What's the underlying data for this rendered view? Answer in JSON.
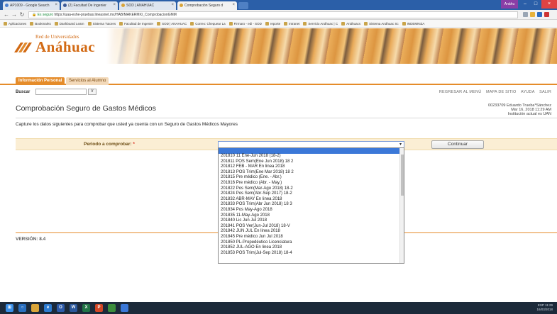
{
  "browser": {
    "tabs": [
      {
        "label": "AP1009 - Google Search"
      },
      {
        "label": "(2) Facultad De Ingenier"
      },
      {
        "label": "SOD | ANAHUAC"
      },
      {
        "label": "Comprobación Seguro d"
      }
    ],
    "active_tab": 3,
    "window_user": "Anáhu",
    "url_secure": "Es seguro",
    "url": "https://uaa-eshe-pruebas.lineasnet.mx/HAB/MAKERMX/_ComprobacionGMM",
    "bookmarks": [
      "Aplicaciones",
      "Bookmarks",
      "Dashboard Learn",
      "Sistema Tutores",
      "Facultad de Ingenier",
      "SOD | ANAHUAC",
      "Correo: Chequear La",
      "Firmaro - edi - SOD",
      "reporte",
      "Intranet",
      "Servicio Anáhuac | C",
      "Anáhuacs",
      "Sistema Anáhuac Sc",
      "INDEMNIZA"
    ]
  },
  "header": {
    "logo_small": "Red de Universidades",
    "logo_big": "Anáhuac"
  },
  "app_tabs": [
    {
      "label": "Información Personal",
      "active": true
    },
    {
      "label": "Servicios al Alumno",
      "active": false
    }
  ],
  "search": {
    "label": "Buscar",
    "value": "",
    "go_label": "Ir"
  },
  "top_links": [
    "REGRESAR AL MENÚ",
    "MAPA DE SITIO",
    "AYUDA",
    "SALIR"
  ],
  "page": {
    "title": "Comprobación Seguro de Gastos Médicos",
    "user_id_line": "00233709 Eduardo Trueba*Sánchez",
    "date_line": "Mar 16, 2018 11:29 AM",
    "institution_line": "Institución actual es UAN",
    "instruction": "Capture los datos siguientes para comprobar que usted ya cuenta con un Seguro de Gastos Médicos Mayores"
  },
  "form": {
    "period_label": "Periodo a comprobar:",
    "required_mark": "*",
    "period_value": "",
    "continue_label": "Continuar",
    "period_options": [
      "201810 11 Ene-Jun 2018 (18-2)",
      "201811 POS Sem(Ene Jun 2018) 18 2",
      "201812 FEB - MAR En linea 2018",
      "201813 POS Trim(Ene Mar 2018) 18 2",
      "201815 Pre médico (Ene. - Abr.)",
      "201816 Pre médico (Abr. - May.)",
      "201822 Pos Sem(Mar-Ago 2018) 18-2",
      "201824 Pos Sem(Abr-Sep 2017) 18-2",
      "201832 ABR-MAY En linea 2018",
      "201833 POS Trim(Abr Jun 2018) 18 3",
      "201834 Pos May-Ago 2018",
      "201835 11-May-Ago 2018",
      "201840 Lic Jun Jul 2018",
      "201841 POS Ver(Jun-Jul 2018) 18-V",
      "201842 JUN JUL En linea 2018",
      "201845 Pre médico Jun Jul 2018",
      "201850 PL-Propedéutico Licenciatura",
      "201852 JUL-AGO En linea 2018",
      "201853 POS Trim(Jul-Sep 2018) 18-4"
    ]
  },
  "footer": {
    "version": "VERSIÓN: 8.4"
  },
  "taskbar": {
    "time": "11:29",
    "date": "16/03/2018",
    "lang": "ESP"
  }
}
